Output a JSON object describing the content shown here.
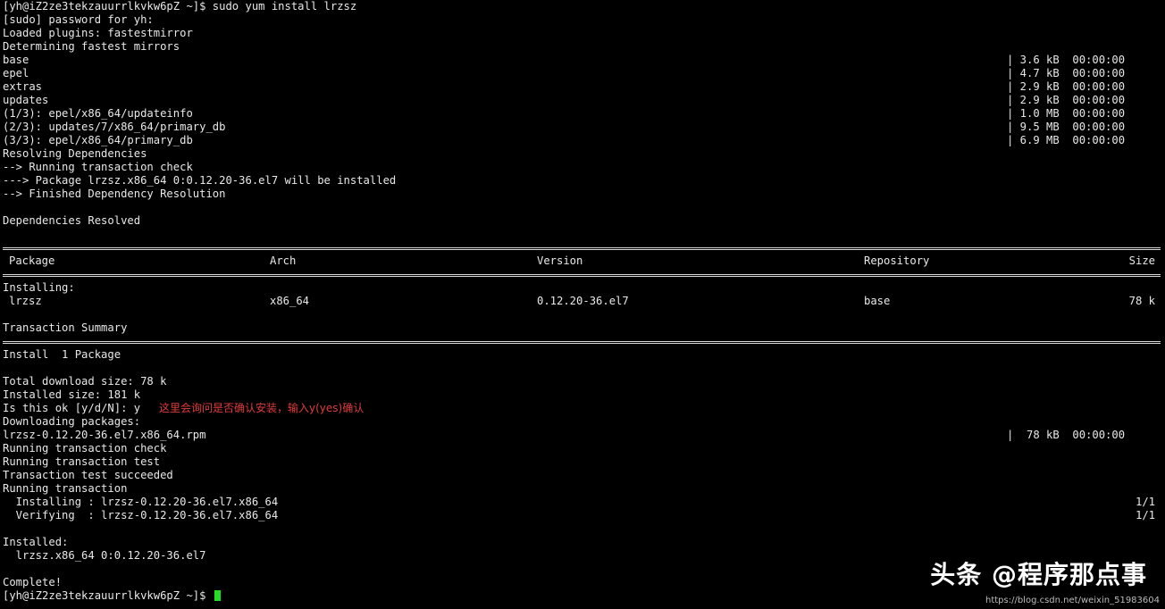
{
  "terminal": {
    "l1": "[yh@iZ2ze3tekzauurrlkvkw6pZ ~]$ sudo yum install lrzsz",
    "l2": "[sudo] password for yh:",
    "l3": "Loaded plugins: fastestmirror",
    "l4": "Determining fastest mirrors",
    "repos": [
      {
        "name": "base",
        "stat": "| 3.6 kB  00:00:00"
      },
      {
        "name": "epel",
        "stat": "| 4.7 kB  00:00:00"
      },
      {
        "name": "extras",
        "stat": "| 2.9 kB  00:00:00"
      },
      {
        "name": "updates",
        "stat": "| 2.9 kB  00:00:00"
      },
      {
        "name": "(1/3): epel/x86_64/updateinfo",
        "stat": "| 1.0 MB  00:00:00"
      },
      {
        "name": "(2/3): updates/7/x86_64/primary_db",
        "stat": "| 9.5 MB  00:00:00"
      },
      {
        "name": "(3/3): epel/x86_64/primary_db",
        "stat": "| 6.9 MB  00:00:00"
      }
    ],
    "l12": "Resolving Dependencies",
    "l13": "--> Running transaction check",
    "l14": "---> Package lrzsz.x86_64 0:0.12.20-36.el7 will be installed",
    "l15": "--> Finished Dependency Resolution",
    "l17": "Dependencies Resolved",
    "table": {
      "headers": [
        "Package",
        "Arch",
        "Version",
        "Repository",
        "Size"
      ],
      "section": "Installing:",
      "row": [
        "lrzsz",
        "x86_64",
        "0.12.20-36.el7",
        "base",
        "78 k"
      ]
    },
    "summary_title": "Transaction Summary",
    "install_count": "Install  1 Package",
    "total_download": "Total download size: 78 k",
    "installed_size": "Installed size: 181 k",
    "prompt_ok": "Is this ok [y/d/N]: y",
    "annotation": "这里会询问是否确认安装，输入y(yes)确认",
    "downloading": "Downloading packages:",
    "rpm_file": "lrzsz-0.12.20-36.el7.x86_64.rpm",
    "rpm_stat": "|  78 kB  00:00:00",
    "run_check": "Running transaction check",
    "run_test": "Running transaction test",
    "test_ok": "Transaction test succeeded",
    "running": "Running transaction",
    "installing_line": "  Installing : lrzsz-0.12.20-36.el7.x86_64",
    "installing_prog": "1/1",
    "verifying_line": "  Verifying  : lrzsz-0.12.20-36.el7.x86_64",
    "verifying_prog": "1/1",
    "installed_label": "Installed:",
    "installed_pkg": "  lrzsz.x86_64 0:0.12.20-36.el7",
    "complete": "Complete!",
    "final_prompt": "[yh@iZ2ze3tekzauurrlkvkw6pZ ~]$ "
  },
  "watermark": {
    "brand": "头条 @程序那点事",
    "url": "https://blog.csdn.net/weixin_51983604"
  },
  "colors": {
    "background": "#000000",
    "text": "#e8e8e8",
    "annotation": "#e23b3b",
    "cursor": "#22dd22"
  }
}
